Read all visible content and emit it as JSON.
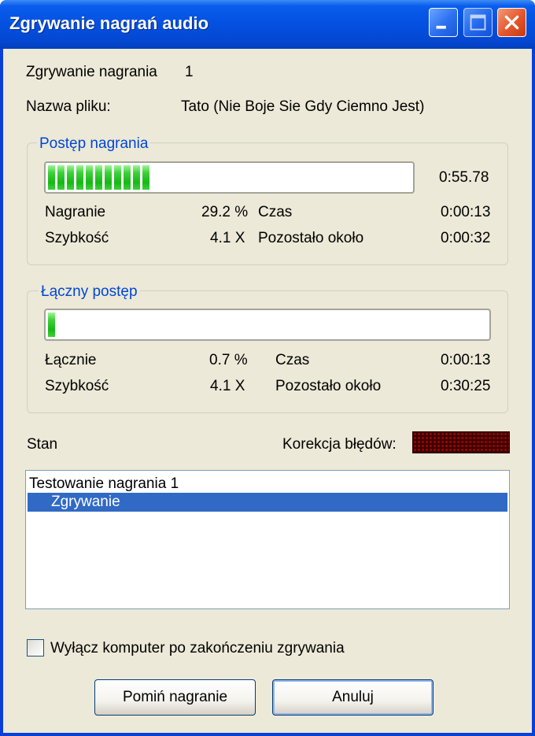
{
  "window": {
    "title": "Zgrywanie nagrań audio"
  },
  "info": {
    "track_label": "Zgrywanie nagrania",
    "track_value": "1",
    "filename_label": "Nazwa pliku:",
    "filename_value": "Tato (Nie Boje Sie Gdy Ciemno Jest)"
  },
  "track_progress": {
    "group_title": "Postęp nagrania",
    "fill_percent": 29.2,
    "duration": "0:55.78",
    "progress_label": "Nagranie",
    "progress_value": "29.2 %",
    "time_label": "Czas",
    "time_value": "0:00:13",
    "speed_label": "Szybkość",
    "speed_value": "4.1 X",
    "remaining_label": "Pozostało około",
    "remaining_value": "0:00:32"
  },
  "total_progress": {
    "group_title": "Łączny postęp",
    "fill_percent": 0.7,
    "progress_label": "Łącznie",
    "progress_value": "0.7 %",
    "time_label": "Czas",
    "time_value": "0:00:13",
    "speed_label": "Szybkość",
    "speed_value": "4.1 X",
    "remaining_label": "Pozostało około",
    "remaining_value": "0:30:25"
  },
  "status": {
    "label": "Stan",
    "error_correction_label": "Korekcja błędów:",
    "log": [
      {
        "text": "Testowanie nagrania  1"
      },
      {
        "text": "Zgrywanie"
      }
    ]
  },
  "shutdown_checkbox": {
    "label": "Wyłącz komputer po zakończeniu zgrywania",
    "checked": false
  },
  "buttons": {
    "skip": "Pomiń nagranie",
    "cancel": "Anuluj"
  },
  "colors": {
    "titlebar": "#0450e0",
    "dialog_bg": "#ece9d8",
    "group_title": "#0046d5",
    "progress_fill": "#17b717",
    "selection": "#316ac5",
    "led_off": "#3a0000"
  }
}
